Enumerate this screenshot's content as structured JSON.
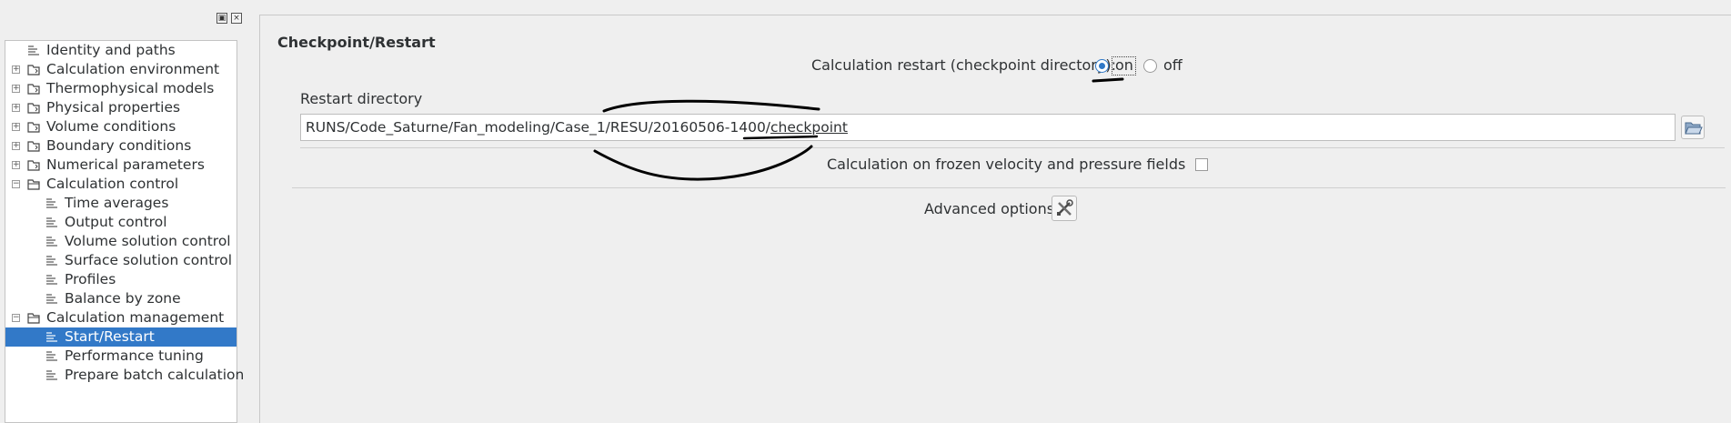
{
  "dock": {
    "float_icon": "float-dock-icon",
    "close_icon": "close-dock-icon",
    "tree": [
      {
        "label": "Identity and paths",
        "level": 0,
        "expander": "",
        "icon": "page-icon"
      },
      {
        "label": "Calculation environment",
        "level": 0,
        "expander": "+",
        "icon": "folder-icon"
      },
      {
        "label": "Thermophysical models",
        "level": 0,
        "expander": "+",
        "icon": "folder-icon"
      },
      {
        "label": "Physical properties",
        "level": 0,
        "expander": "+",
        "icon": "folder-icon"
      },
      {
        "label": "Volume conditions",
        "level": 0,
        "expander": "+",
        "icon": "folder-icon"
      },
      {
        "label": "Boundary conditions",
        "level": 0,
        "expander": "+",
        "icon": "folder-icon"
      },
      {
        "label": "Numerical parameters",
        "level": 0,
        "expander": "+",
        "icon": "folder-icon"
      },
      {
        "label": "Calculation control",
        "level": 0,
        "expander": "-",
        "icon": "folder-open-icon"
      },
      {
        "label": "Time averages",
        "level": 1,
        "expander": "",
        "icon": "page-icon"
      },
      {
        "label": "Output control",
        "level": 1,
        "expander": "",
        "icon": "page-icon"
      },
      {
        "label": "Volume solution control",
        "level": 1,
        "expander": "",
        "icon": "page-icon"
      },
      {
        "label": "Surface solution control",
        "level": 1,
        "expander": "",
        "icon": "page-icon"
      },
      {
        "label": "Profiles",
        "level": 1,
        "expander": "",
        "icon": "page-icon"
      },
      {
        "label": "Balance by zone",
        "level": 1,
        "expander": "",
        "icon": "page-icon"
      },
      {
        "label": "Calculation management",
        "level": 0,
        "expander": "-",
        "icon": "folder-open-icon"
      },
      {
        "label": "Start/Restart",
        "level": 1,
        "expander": "",
        "icon": "page-icon",
        "selected": true
      },
      {
        "label": "Performance tuning",
        "level": 1,
        "expander": "",
        "icon": "page-icon"
      },
      {
        "label": "Prepare batch calculation",
        "level": 1,
        "expander": "",
        "icon": "page-icon"
      }
    ]
  },
  "main": {
    "title": "Checkpoint/Restart",
    "restart_label": "Calculation restart (checkpoint directory):",
    "restart_options": [
      {
        "label": "on",
        "checked": true
      },
      {
        "label": "off",
        "checked": false
      }
    ],
    "restart_dir_label": "Restart directory",
    "restart_dir_prefix": "RUNS/Code_Saturne/Fan_modeling/Case_1/RESU/20160506-1400/",
    "restart_dir_suffix": "checkpoint",
    "browse_icon": "folder-open-icon",
    "frozen_label": "Calculation on frozen velocity and pressure fields",
    "frozen_checked": false,
    "advanced_label": "Advanced options",
    "advanced_icon": "tools-icon"
  },
  "colors": {
    "selection": "#3279c8",
    "radio_accent": "#2f78c7",
    "annotation_ink": "#000000"
  }
}
